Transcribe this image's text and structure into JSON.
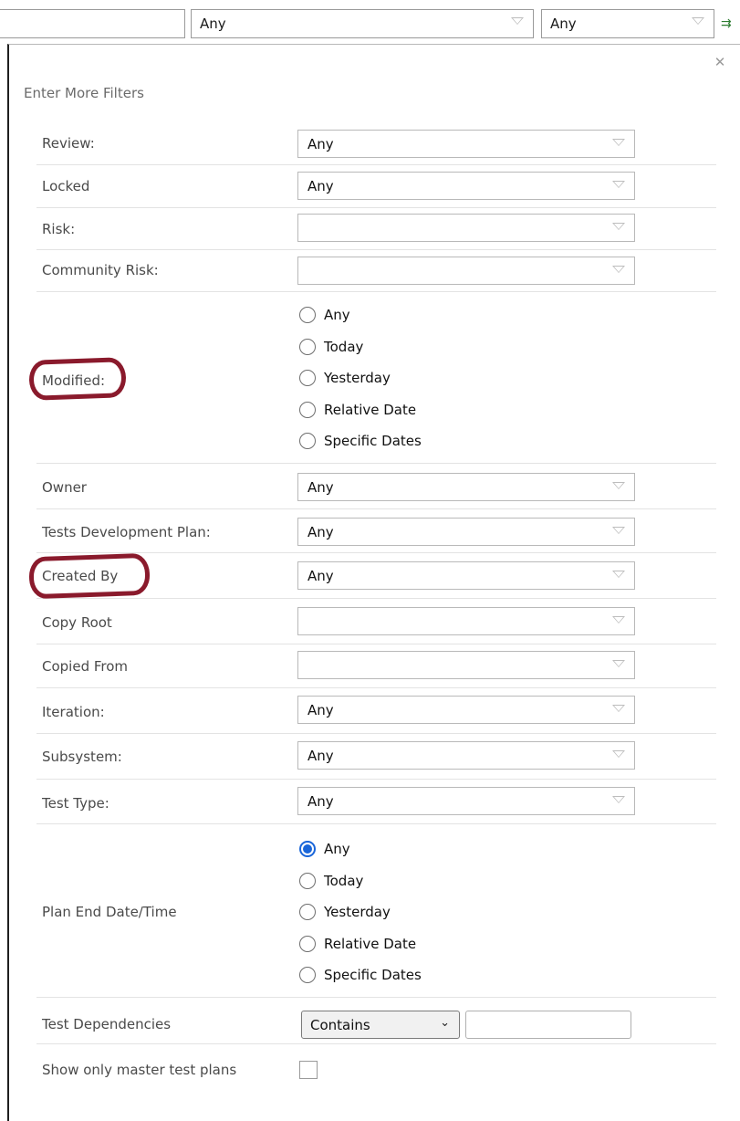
{
  "topbar": {
    "select1_value": "Any",
    "select2_value": "Any"
  },
  "panel": {
    "title": "Enter More Filters"
  },
  "filters": {
    "review": {
      "label": "Review:",
      "value": "Any"
    },
    "locked": {
      "label": "Locked",
      "value": "Any"
    },
    "risk": {
      "label": "Risk:",
      "value": ""
    },
    "community_risk": {
      "label": "Community Risk:",
      "value": ""
    },
    "modified": {
      "label": "Modified:",
      "options": [
        "Any",
        "Today",
        "Yesterday",
        "Relative Date",
        "Specific Dates"
      ],
      "selected": null
    },
    "owner": {
      "label": "Owner",
      "value": "Any"
    },
    "tests_dev_plan": {
      "label": "Tests Development Plan:",
      "value": "Any"
    },
    "created_by": {
      "label": "Created By",
      "value": "Any"
    },
    "copy_root": {
      "label": "Copy Root",
      "value": ""
    },
    "copied_from": {
      "label": "Copied From",
      "value": ""
    },
    "iteration": {
      "label": "Iteration:",
      "value": "Any"
    },
    "subsystem": {
      "label": "Subsystem:",
      "value": "Any"
    },
    "test_type": {
      "label": "Test Type:",
      "value": "Any"
    },
    "plan_end": {
      "label": "Plan End Date/Time",
      "options": [
        "Any",
        "Today",
        "Yesterday",
        "Relative Date",
        "Specific Dates"
      ],
      "selected": "Any"
    },
    "test_dependencies": {
      "label": "Test Dependencies",
      "operator": "Contains",
      "value": ""
    },
    "master_only": {
      "label": "Show only master test plans",
      "checked": false
    }
  },
  "colors": {
    "highlight": "#8a1a2c",
    "radio_selected": "#1a66d9"
  }
}
